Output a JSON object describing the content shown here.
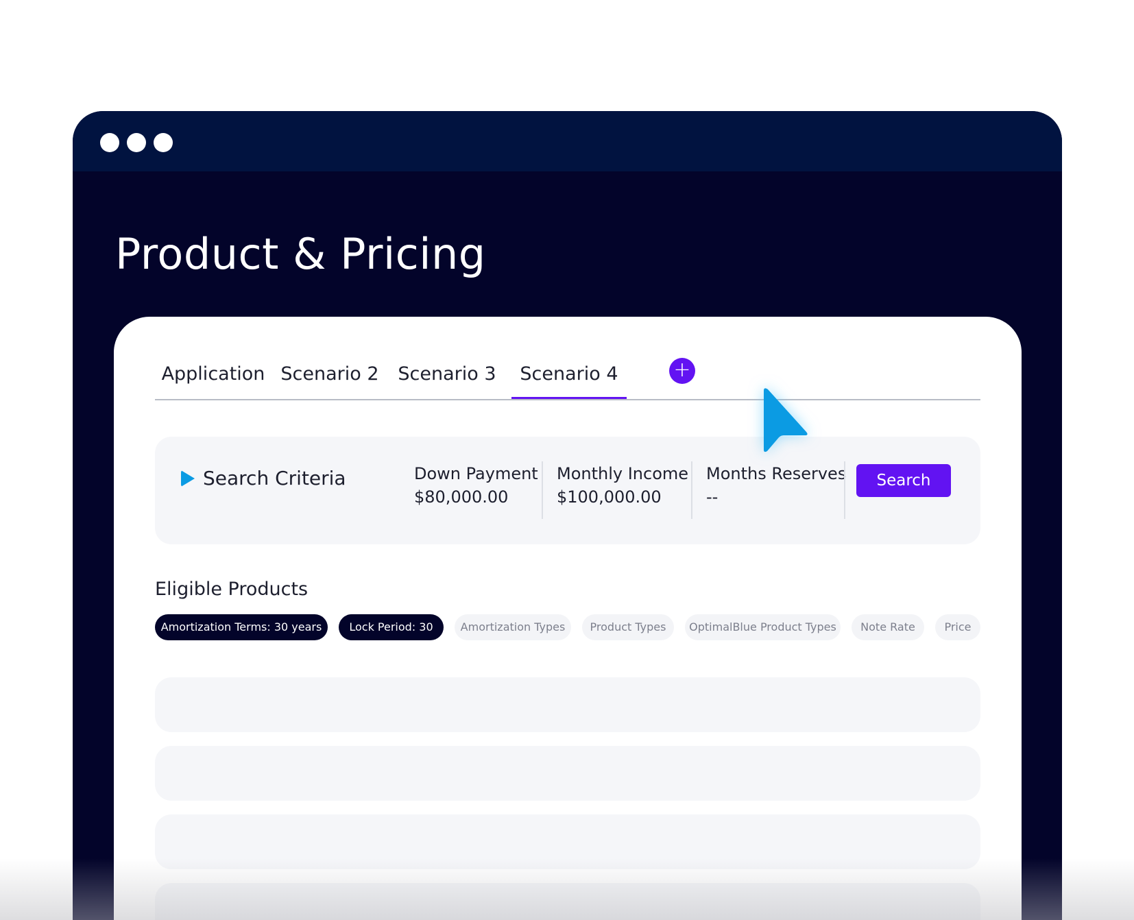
{
  "window": {
    "dots": [
      "window-dot-1",
      "window-dot-2",
      "window-dot-3"
    ]
  },
  "page": {
    "title": "Product & Pricing"
  },
  "tabs": [
    {
      "label": "Application",
      "active": false
    },
    {
      "label": "Scenario 2",
      "active": false
    },
    {
      "label": "Scenario 3",
      "active": false
    },
    {
      "label": "Scenario 4",
      "active": true
    }
  ],
  "add_tab": {
    "label": "+",
    "icon": "plus-circle-icon"
  },
  "criteria": {
    "toggle_label": "Search Criteria",
    "toggle_icon": "play-triangle-icon",
    "fields": [
      {
        "label": "Down Payment",
        "value": "$80,000.00"
      },
      {
        "label": "Monthly Income",
        "value": "$100,000.00"
      },
      {
        "label": "Months Reserves",
        "value": "--"
      }
    ],
    "search_label": "Search"
  },
  "eligible": {
    "title": "Eligible Products",
    "filters": [
      {
        "label": "Amortization Terms: 30 years",
        "selected": true
      },
      {
        "label": "Lock Period: 30",
        "selected": true
      },
      {
        "label": "Amortization Types",
        "selected": false
      },
      {
        "label": "Product Types",
        "selected": false
      },
      {
        "label": "OptimalBlue Product Types",
        "selected": false
      },
      {
        "label": "Note Rate",
        "selected": false
      },
      {
        "label": "Price",
        "selected": false
      }
    ]
  },
  "colors": {
    "window_bg": "#03042a",
    "titlebar_bg": "#011340",
    "accent": "#6213f2",
    "cursor": "#0b9be3",
    "card_bg": "#f5f6f9",
    "text": "#1d1f2e"
  }
}
